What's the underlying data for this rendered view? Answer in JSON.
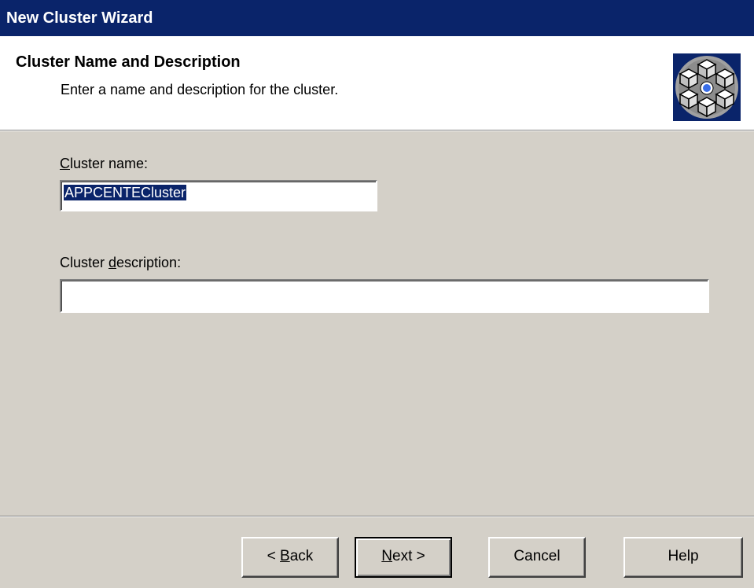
{
  "window": {
    "title": "New Cluster Wizard"
  },
  "header": {
    "title": "Cluster Name and Description",
    "subtitle": "Enter a name and description for the cluster.",
    "icon": "cluster-cubes-icon"
  },
  "form": {
    "cluster_name": {
      "label_accel": "C",
      "label_rest": "luster name:",
      "value": "APPCENTECluster"
    },
    "cluster_description": {
      "label_pre": "Cluster ",
      "label_accel": "d",
      "label_rest": "escription:",
      "value": ""
    }
  },
  "buttons": {
    "back": {
      "pre": "< ",
      "accel": "B",
      "rest": "ack"
    },
    "next": {
      "pre": "",
      "accel": "N",
      "rest": "ext >"
    },
    "cancel": {
      "label": "Cancel"
    },
    "help": {
      "label": "Help"
    }
  },
  "colors": {
    "title_bar": "#0a246a",
    "dialog_face": "#d4d0c8",
    "selection": "#0a246a"
  }
}
